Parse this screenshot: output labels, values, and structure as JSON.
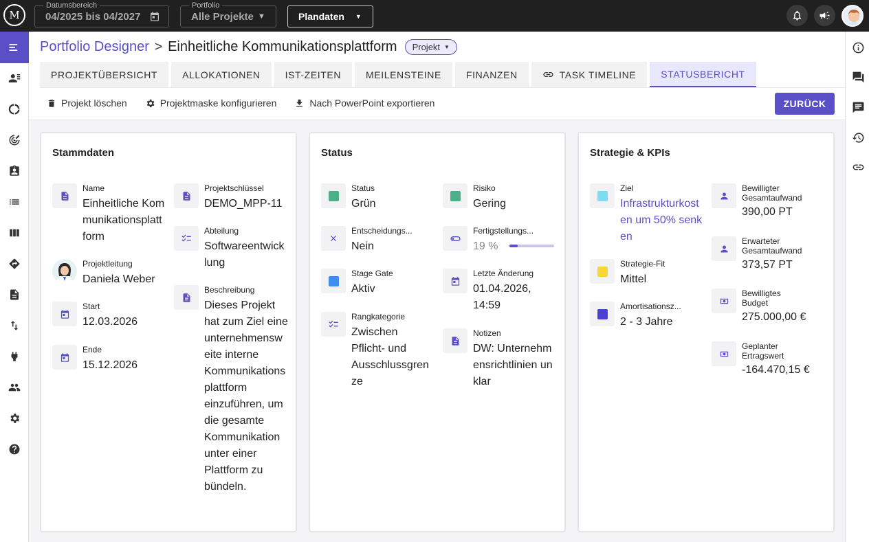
{
  "topbar": {
    "logo_text": "M",
    "date_range": {
      "label": "Datumsbereich",
      "value": "04/2025 bis 04/2027"
    },
    "portfolio": {
      "label": "Portfolio",
      "value": "Alle Projekte"
    },
    "plan_select": "Plandaten"
  },
  "breadcrumb": {
    "root": "Portfolio Designer",
    "separator": ">",
    "current": "Einheitliche Kommunikationsplattform",
    "type_chip": "Projekt"
  },
  "tabs": [
    "PROJEKTÜBERSICHT",
    "ALLOKATIONEN",
    "IST-ZEITEN",
    "MEILENSTEINE",
    "FINANZEN",
    "TASK TIMELINE",
    "STATUSBERICHT"
  ],
  "active_tab": "STATUSBERICHT",
  "actions": {
    "delete": "Projekt löschen",
    "configure": "Projektmaske konfigurieren",
    "export": "Nach PowerPoint exportieren",
    "back": "ZURÜCK"
  },
  "stammdaten": {
    "title": "Stammdaten",
    "name": {
      "label": "Name",
      "value": "Einheitliche Kommunikationsplattform"
    },
    "projektleitung": {
      "label": "Projektleitung",
      "value": "Daniela Weber"
    },
    "start": {
      "label": "Start",
      "value": "12.03.2026"
    },
    "ende": {
      "label": "Ende",
      "value": "15.12.2026"
    },
    "projektschluessel": {
      "label": "Projektschlüssel",
      "value": "DEMO_MPP-11"
    },
    "abteilung": {
      "label": "Abteilung",
      "value": "Softwareentwicklung"
    },
    "beschreibung": {
      "label": "Beschreibung",
      "value": "Dieses Projekt hat zum Ziel eine unternehmensweite interne Kommunikationsplattform einzuführen, um die gesamte Kommunikation unter einer Plattform zu bündeln."
    }
  },
  "status": {
    "title": "Status",
    "status": {
      "label": "Status",
      "value": "Grün",
      "color": "#4caf8a"
    },
    "entscheidung": {
      "label": "Entscheidungs...",
      "value": "Nein"
    },
    "stage_gate": {
      "label": "Stage Gate",
      "value": "Aktiv",
      "color": "#3d8ef0"
    },
    "rangkategorie": {
      "label": "Rangkategorie",
      "value": "Zwischen Pflicht- und Ausschlussgrenze"
    },
    "risiko": {
      "label": "Risiko",
      "value": "Gering",
      "color": "#4caf8a"
    },
    "fertigstellung": {
      "label": "Fertigstellungs...",
      "value": "19 %",
      "progress": 0.19
    },
    "letzte_aenderung": {
      "label": "Letzte Änderung",
      "value": "01.04.2026, 14:59"
    },
    "notizen": {
      "label": "Notizen",
      "value": "DW: Unternehmensrichtlinien unklar"
    }
  },
  "strategie": {
    "title": "Strategie & KPIs",
    "ziel": {
      "label": "Ziel",
      "value": "Infrastrukturkosten um 50% senken",
      "color": "#7ddcf4"
    },
    "strategie_fit": {
      "label": "Strategie-Fit",
      "value": "Mittel",
      "color": "#f5d836"
    },
    "amortisation": {
      "label": "Amortisationsz...",
      "value": "2 - 3 Jahre",
      "color": "#4b3fd6"
    },
    "bew_aufwand": {
      "label": "Bewilligter Gesamtaufwand",
      "value": "390,00 PT"
    },
    "erw_aufwand": {
      "label": "Erwarteter Gesamtaufwand",
      "value": "373,57 PT"
    },
    "bew_budget": {
      "label": "Bewilligtes Budget",
      "value": "275.000,00 €"
    },
    "ertragswert": {
      "label": "Geplanter Ertragswert",
      "value": "-164.470,15 €"
    }
  },
  "colors": {
    "accent": "#5b4fc7",
    "topbar": "#202020"
  }
}
